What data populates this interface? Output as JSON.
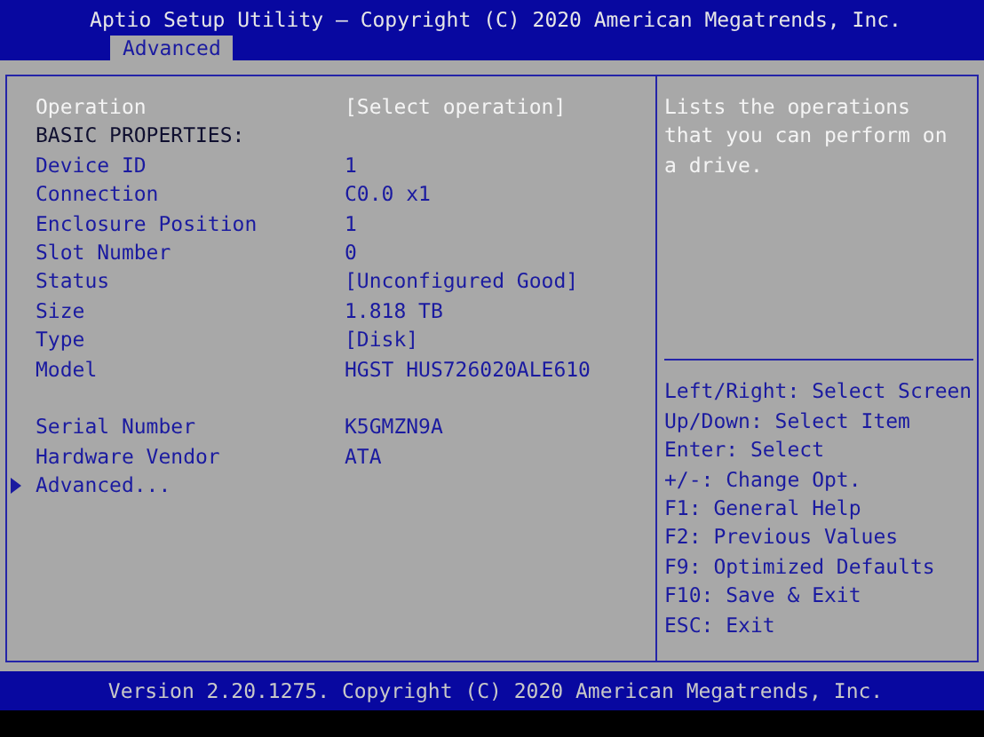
{
  "window": {
    "title": "Aptio Setup Utility – Copyright (C) 2020 American Megatrends, Inc."
  },
  "tabs": [
    {
      "label": "Advanced",
      "selected": true
    }
  ],
  "settings": [
    {
      "kind": "item",
      "label": "Operation",
      "value": "[Select operation]",
      "selected": true
    },
    {
      "kind": "heading",
      "label": "BASIC PROPERTIES:"
    },
    {
      "kind": "item",
      "label": "Device ID",
      "value": "1",
      "selected": false
    },
    {
      "kind": "item",
      "label": "Connection",
      "value": "C0.0 x1",
      "selected": false
    },
    {
      "kind": "item",
      "label": "Enclosure Position",
      "value": "1",
      "selected": false
    },
    {
      "kind": "item",
      "label": "Slot Number",
      "value": "0",
      "selected": false
    },
    {
      "kind": "item",
      "label": "Status",
      "value": "[Unconfigured Good]",
      "selected": false
    },
    {
      "kind": "item",
      "label": "Size",
      "value": "1.818 TB",
      "selected": false
    },
    {
      "kind": "item",
      "label": "Type",
      "value": "[Disk]",
      "selected": false
    },
    {
      "kind": "item",
      "label": "Model",
      "value": "HGST HUS726020ALE610",
      "selected": false
    },
    {
      "kind": "spacer"
    },
    {
      "kind": "item",
      "label": "Serial Number",
      "value": "K5GMZN9A",
      "selected": false
    },
    {
      "kind": "item",
      "label": "Hardware Vendor",
      "value": "ATA",
      "selected": false
    },
    {
      "kind": "submenu",
      "label": "Advanced...",
      "selected": false
    }
  ],
  "help": {
    "text": "Lists the operations that you can perform on a drive.",
    "keys": [
      "Left/Right: Select Screen",
      "Up/Down: Select Item",
      "Enter: Select",
      "+/-: Change Opt.",
      "F1: General Help",
      "F2: Previous Values",
      "F9: Optimized Defaults",
      "F10: Save & Exit",
      "ESC: Exit"
    ]
  },
  "footer": {
    "text": "Version 2.20.1275. Copyright (C) 2020 American Megatrends, Inc."
  }
}
